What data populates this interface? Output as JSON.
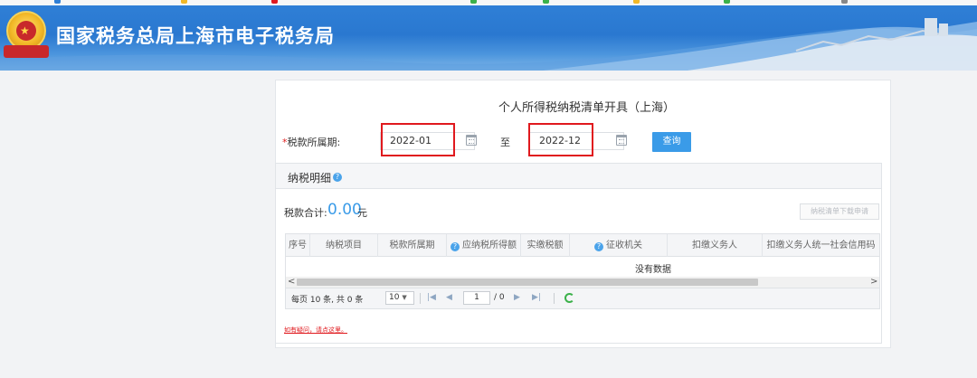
{
  "banner": {
    "title": "国家税务总局上海市电子税务局",
    "colors": {
      "sky": "#2f7fd6",
      "mountain": "#e9eef4"
    },
    "emblem_icon": "national-tax-emblem"
  },
  "form": {
    "page_title": "个人所得税纳税清单开具（上海）",
    "required_mark": "*",
    "period_label": "税款所属期:",
    "start_value": "2022-01",
    "to_label": "至",
    "end_value": "2022-12",
    "query_label": "查询",
    "calendar_icon": "calendar-icon",
    "accent": "#3a9be8",
    "highlight_color": "#e0191e"
  },
  "detail": {
    "title": "纳税明细",
    "total_label": "税款合计:",
    "total_value": "0.00",
    "total_unit": "元",
    "download_label": "纳税清单下载申请",
    "columns": [
      "序号",
      "纳税项目",
      "税款所属期",
      "应纳税所得额",
      "实缴税额",
      "征收机关",
      "扣缴义务人",
      "扣缴义务人统一社会信用码"
    ],
    "help_columns": [
      "应纳税所得额",
      "征收机关"
    ],
    "no_data": "没有数据",
    "scroll_left": "<",
    "scroll_right": ">"
  },
  "pager": {
    "summary": "每页 10 条, 共 0 条",
    "page_size": "10",
    "page_input": "1",
    "page_total": "/ 0",
    "first": "|◀",
    "prev": "◀",
    "next": "▶",
    "last": "▶|"
  },
  "footer": {
    "help_link": "如有疑问，请点这里。"
  }
}
